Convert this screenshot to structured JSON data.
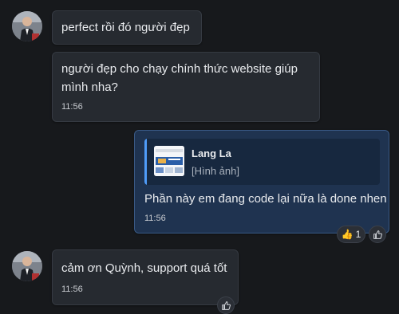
{
  "messages": [
    {
      "text": "perfect rồi đó người đẹp"
    },
    {
      "lines": [
        "người đẹp cho chạy chính thức website giúp",
        "mình nha?"
      ],
      "time": "11:56"
    },
    {
      "quote": {
        "sender": "Lang La",
        "preview": "[Hình ảnh]"
      },
      "text": "Phần này em đang code lại nữa là done nhen",
      "time": "11:56",
      "reaction": {
        "emoji": "👍",
        "count": "1"
      }
    },
    {
      "text": "cảm ơn Quỳnh, support quá tốt",
      "time": "11:56"
    }
  ],
  "colors": {
    "background": "#17191c",
    "incoming_bubble": "#262a30",
    "outgoing_bubble": "#1f3350",
    "quote_accent": "#4f9cf9"
  },
  "icons": [
    "avatar",
    "thumbs-up-icon",
    "image-thumbnail"
  ]
}
